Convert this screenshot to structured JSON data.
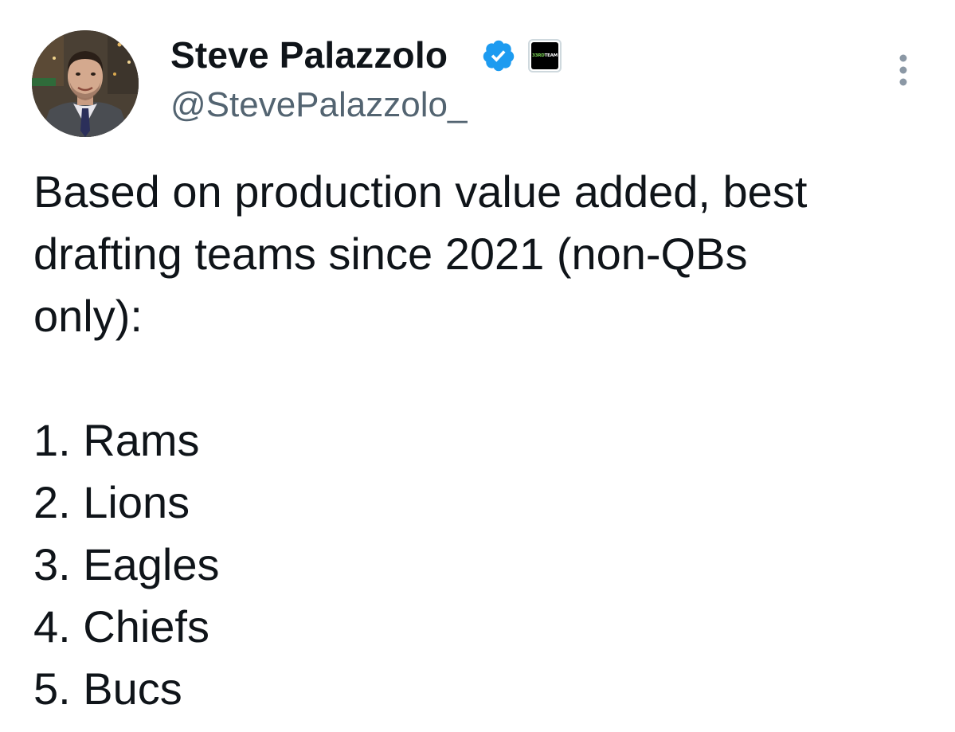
{
  "author": {
    "display_name": "Steve Palazzolo",
    "handle": "@StevePalazzolo_",
    "verified": true,
    "verified_color": "#1d9bf0",
    "affiliate_badge": {
      "number": "33RD",
      "word": "TEAM"
    }
  },
  "tweet": {
    "intro_lines": [
      "Based on production value added, best",
      "drafting teams since 2021 (non-QBs",
      "only):"
    ],
    "ranking": [
      "1. Rams",
      "2. Lions",
      "3. Eagles",
      "4. Chiefs",
      "5. Bucs"
    ]
  },
  "icons": {
    "avatar": "profile-photo",
    "verified": "verified-badge-icon",
    "affiliate": "affiliate-badge-icon",
    "more": "more-options-icon"
  },
  "colors": {
    "text": "#0f1419",
    "secondary_text": "#536471",
    "accent": "#1d9bf0"
  }
}
